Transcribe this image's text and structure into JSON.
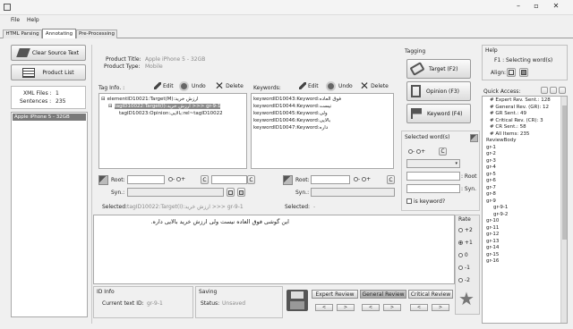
{
  "window": {
    "controls": [
      "–",
      "▫",
      "✕"
    ]
  },
  "menu": [
    "File",
    "Help"
  ],
  "tabs": [
    "HTML Parsing",
    "Annotating",
    "Pre-Processing"
  ],
  "left": {
    "clear_label": "Clear Source Text",
    "product_list_label": "Product List",
    "xml_files_label": "XML Files :",
    "xml_files_value": "1",
    "sentences_label": "Sentences :",
    "sentences_value": "235",
    "list_item": "Apple iPhone 5 - 32GB"
  },
  "product": {
    "title_label": "Product Title:",
    "title_value": "Apple iPhone 5 - 32GB",
    "type_label": "Product Type:",
    "type_value": "Mobile"
  },
  "taginfo": {
    "header": "Tag Info. :",
    "edit": "Edit",
    "undo": "Undo",
    "delete": "Delete",
    "tree": [
      {
        "text": "elementID10021:Target(M):ارزش خرید",
        "indent": 0
      },
      {
        "text": "tagID10022:Target(I):ارزش خرید >>> gr-9-1",
        "indent": 1,
        "selected": true
      },
      {
        "text": "tagID10023:Opinion:بالایی:rel~tagID10022",
        "indent": 2
      }
    ]
  },
  "keywords": {
    "header": "Keywords:",
    "edit": "Edit",
    "undo": "Undo",
    "delete": "Delete",
    "items": [
      "keywordID10043:Keyword:فوق العاده",
      "keywordID10044:Keyword:نیست",
      "keywordID10045:Keyword:ولی",
      "keywordID10046:Keyword:بالایی",
      "keywordID10047:Keyword:داره"
    ]
  },
  "root_left": {
    "root_label": "Root:",
    "syn_label": "Syn.:",
    "selected_label": "Selected:",
    "selected_value": "tagID10022:Target(I):ارزش خرید >>> gr-9-1",
    "minus": "-",
    "plus": "+",
    "c": "C"
  },
  "root_right": {
    "root_label": "Root:",
    "syn_label": "Syn.:",
    "selected_label": "Selected:",
    "selected_value": "-",
    "minus": "-",
    "plus": "+",
    "c": "C"
  },
  "tagging": {
    "header": "Tagging",
    "target": "Target (F2)",
    "opinion": "Opinion (F3)",
    "keyword": "Keyword (F4)"
  },
  "selected_words": {
    "header": "Selected word(s)",
    "root": ": Root",
    "syn": ": Syn.",
    "is_keyword": "is keyword?",
    "minus": "-",
    "plus": "+",
    "c": "C"
  },
  "sentence": {
    "text": "این گوشی فوق العاده نیست ولی ارزش خرید بالایی داره."
  },
  "rate": {
    "header": "Rate",
    "options": [
      "+2",
      "+1",
      "0",
      "-1",
      "-2"
    ],
    "selected": 1
  },
  "id_info": {
    "header": "ID Info",
    "current_label": "Current text ID:",
    "current_value": "gr-9-1"
  },
  "saving": {
    "header": "Saving",
    "status_label": "Status:",
    "status_value": "Unsaved"
  },
  "review": {
    "tabs": [
      "Expert Review",
      "General Review",
      "Critical Review"
    ],
    "active": 1,
    "prev": "<",
    "next": ">"
  },
  "help": {
    "header": "Help",
    "selecting": "Selecting word(s)",
    "f1": "F1 :",
    "align": "Align:"
  },
  "quick": {
    "header": "Quick Access:",
    "items": [
      {
        "t": "# Expert Rev. Sent.: 128",
        "l": 1
      },
      {
        "t": "# General Rev. (GR): 12",
        "l": 1
      },
      {
        "t": "# GR Sent.: 49",
        "l": 1
      },
      {
        "t": "# Critical Rev. (CR): 3",
        "l": 1
      },
      {
        "t": "# CR Sent.: 58",
        "l": 1
      },
      {
        "t": "# All Items: 235",
        "l": 1
      },
      {
        "t": "ReviewBody",
        "l": 0
      },
      {
        "t": "gr-1",
        "l": 0
      },
      {
        "t": "gr-2",
        "l": 0
      },
      {
        "t": "gr-3",
        "l": 0
      },
      {
        "t": "gr-4",
        "l": 0
      },
      {
        "t": "gr-5",
        "l": 0
      },
      {
        "t": "gr-6",
        "l": 0
      },
      {
        "t": "gr-7",
        "l": 0
      },
      {
        "t": "gr-8",
        "l": 0
      },
      {
        "t": "gr-9",
        "l": 0
      },
      {
        "t": "gr-9-1",
        "l": 2
      },
      {
        "t": "gr-9-2",
        "l": 2
      },
      {
        "t": "gr-10",
        "l": 0
      },
      {
        "t": "gr-11",
        "l": 0
      },
      {
        "t": "gr-12",
        "l": 0
      },
      {
        "t": "gr-13",
        "l": 0
      },
      {
        "t": "gr-14",
        "l": 0
      },
      {
        "t": "gr-15",
        "l": 0
      },
      {
        "t": "gr-16",
        "l": 0
      }
    ]
  }
}
